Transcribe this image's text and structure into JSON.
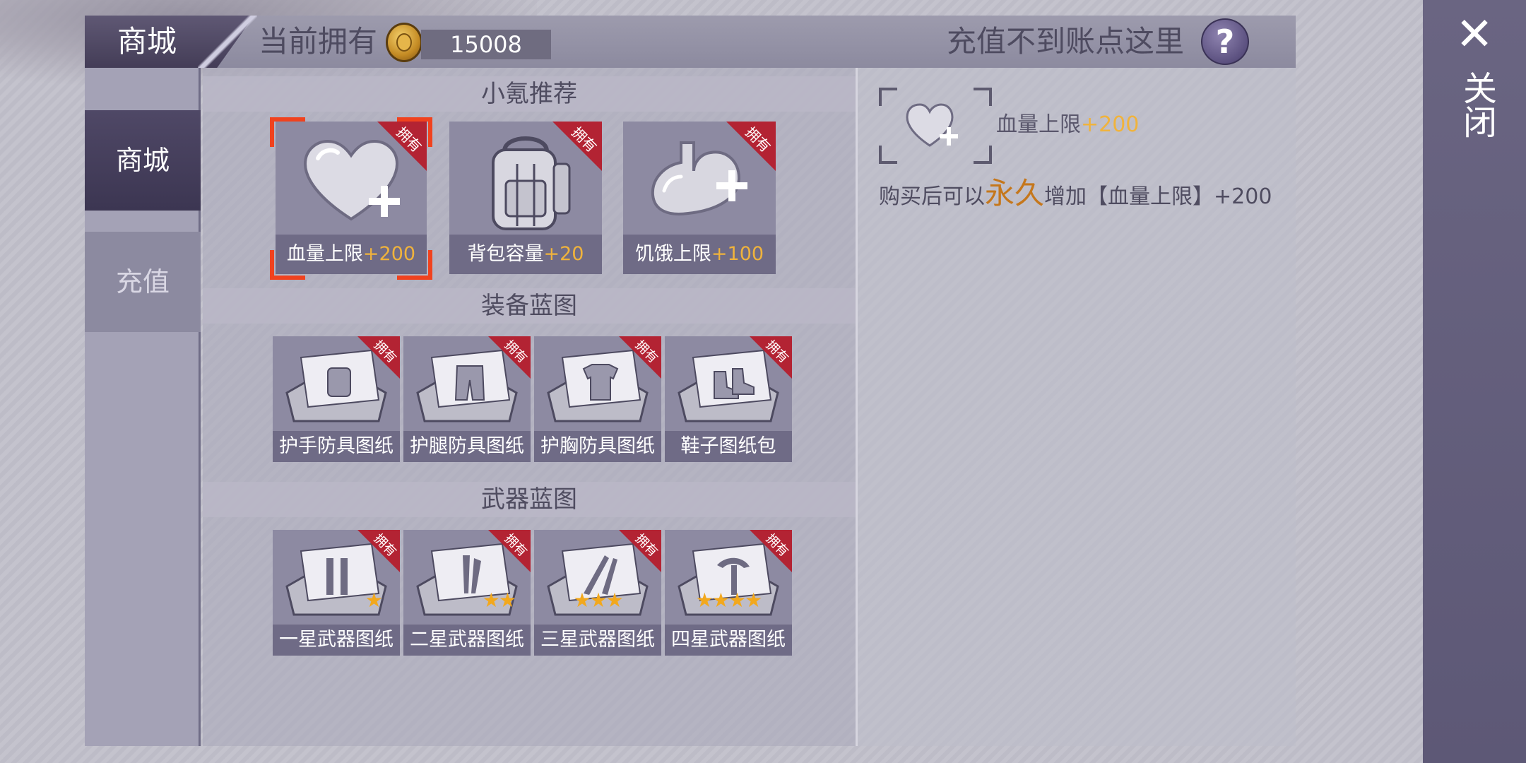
{
  "header": {
    "title": "商城",
    "owned_label": "当前拥有",
    "coin_icon": "gold-coin-icon",
    "coin_amount": "15008",
    "recharge_issue": "充值不到账点这里",
    "help_label": "?"
  },
  "sidebar": {
    "tabs": [
      {
        "label": "商城",
        "active": true
      },
      {
        "label": "充值",
        "active": false
      }
    ]
  },
  "sections": {
    "recommend": {
      "title": "小氪推荐",
      "items": [
        {
          "name": "血量上限",
          "bonus": "+200",
          "owned_badge": "拥有",
          "icon": "heart-plus-icon",
          "selected": true
        },
        {
          "name": "背包容量",
          "bonus": "+20",
          "owned_badge": "拥有",
          "icon": "backpack-icon",
          "selected": false
        },
        {
          "name": "饥饿上限",
          "bonus": "+100",
          "owned_badge": "拥有",
          "icon": "stomach-plus-icon",
          "selected": false
        }
      ]
    },
    "equipment": {
      "title": "装备蓝图",
      "items": [
        {
          "name": "护手防具图纸",
          "owned_badge": "拥有",
          "icon": "gloves-blueprint-icon"
        },
        {
          "name": "护腿防具图纸",
          "owned_badge": "拥有",
          "icon": "pants-blueprint-icon"
        },
        {
          "name": "护胸防具图纸",
          "owned_badge": "拥有",
          "icon": "chest-blueprint-icon"
        },
        {
          "name": "鞋子图纸包",
          "owned_badge": "拥有",
          "icon": "shoes-blueprint-icon"
        }
      ]
    },
    "weapons": {
      "title": "武器蓝图",
      "items": [
        {
          "name": "一星武器图纸",
          "owned_badge": "拥有",
          "stars": "★",
          "icon": "weapon-blueprint-icon"
        },
        {
          "name": "二星武器图纸",
          "owned_badge": "拥有",
          "stars": "★★",
          "icon": "weapon-blueprint-icon"
        },
        {
          "name": "三星武器图纸",
          "owned_badge": "拥有",
          "stars": "★★★",
          "icon": "weapon-blueprint-icon"
        },
        {
          "name": "四星武器图纸",
          "owned_badge": "拥有",
          "stars": "★★★★",
          "icon": "weapon-blueprint-icon"
        }
      ]
    }
  },
  "detail": {
    "icon": "heart-plus-icon",
    "name": "血量上限",
    "bonus": "+200",
    "desc_prefix": "购买后可以",
    "desc_highlight": "永久",
    "desc_suffix": "增加【血量上限】+200"
  },
  "close": {
    "icon": "close-x-icon",
    "x_glyph": "✕",
    "label": "关闭"
  },
  "colors": {
    "highlight": "#f0b33c",
    "ribbon": "#b32333",
    "selection": "#f0421e",
    "permanent_text": "#c5771c"
  }
}
